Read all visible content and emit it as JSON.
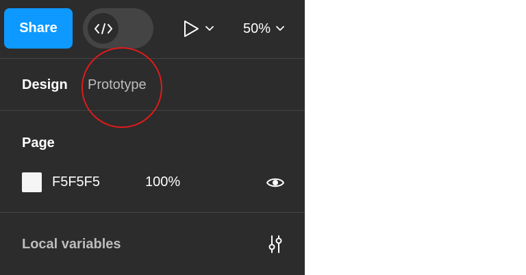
{
  "toolbar": {
    "share_label": "Share",
    "dev_mode_icon": "code-brackets-icon",
    "play_icon": "play-icon",
    "zoom_value": "50%",
    "dropdown_icon": "chevron-down-icon"
  },
  "tabs": [
    {
      "label": "Design",
      "active": true
    },
    {
      "label": "Prototype",
      "active": false
    }
  ],
  "page": {
    "title": "Page",
    "fill_hex": "F5F5F5",
    "fill_opacity": "100%",
    "swatch_color": "#f5f5f5",
    "visibility_icon": "eye-icon"
  },
  "local_variables": {
    "label": "Local variables",
    "icon": "sliders-icon"
  },
  "colors": {
    "panel_bg": "#2c2c2c",
    "accent": "#0d99ff",
    "annotation_circle": "#e21a1a"
  }
}
